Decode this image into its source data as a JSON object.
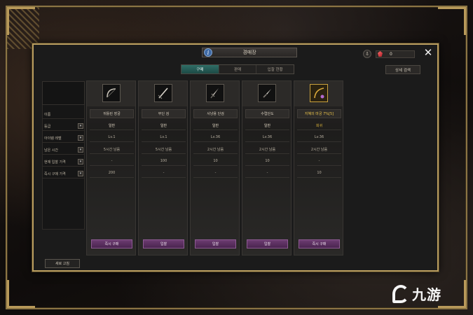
{
  "window": {
    "title": "경매장",
    "close_glyph": "✕"
  },
  "currency": {
    "value": "0"
  },
  "tabs": [
    {
      "label": "구매",
      "active": true
    },
    {
      "label": "판매",
      "active": false
    },
    {
      "label": "입찰 현황",
      "active": false
    }
  ],
  "detail_search_label": "상세 검색",
  "row_labels": [
    {
      "label": "이름",
      "has_dropdown": false
    },
    {
      "label": "등급",
      "has_dropdown": true
    },
    {
      "label": "아이템 레벨",
      "has_dropdown": true
    },
    {
      "label": "남은 시간",
      "has_dropdown": true
    },
    {
      "label": "현재 입찰 가격",
      "has_dropdown": true
    },
    {
      "label": "즉시 구매 가격",
      "has_dropdown": true
    }
  ],
  "items": [
    {
      "name": "뒤틀린 장궁",
      "grade": "일반",
      "level": "Lv.1",
      "time_left": "5시간 남음",
      "current_bid": "-",
      "buyout": "200",
      "button": "즉시 구매",
      "icon": "bow-icon",
      "rare": false
    },
    {
      "name": "무딘 검",
      "grade": "일반",
      "level": "Lv.1",
      "time_left": "5시간 남음",
      "current_bid": "100",
      "buyout": "-",
      "button": "입찰",
      "icon": "sword-icon",
      "rare": false
    },
    {
      "name": "사냥용 단검",
      "grade": "일반",
      "level": "Lv.36",
      "time_left": "2시간 남음",
      "current_bid": "10",
      "buyout": "-",
      "button": "입찰",
      "icon": "dagger-icon",
      "rare": false
    },
    {
      "name": "수렵단도",
      "grade": "일반",
      "level": "Lv.36",
      "time_left": "2시간 남음",
      "current_bid": "10",
      "buyout": "-",
      "button": "입찰",
      "icon": "knife-icon",
      "rare": false
    },
    {
      "name": "지혜의 마궁 7%[5]",
      "grade": "희귀",
      "level": "Lv.36",
      "time_left": "2시간 남음",
      "current_bid": "-",
      "buyout": "10",
      "button": "즉시 구매",
      "icon": "magic-bow-icon",
      "rare": true
    }
  ],
  "reset_label": "새로 고침",
  "watermark": "九游",
  "colors": {
    "frame_gold": "#b89c5e",
    "tab_active": "#2f6d66",
    "button_purple": "#6c3c70",
    "rare_gold": "#e0b83a"
  }
}
